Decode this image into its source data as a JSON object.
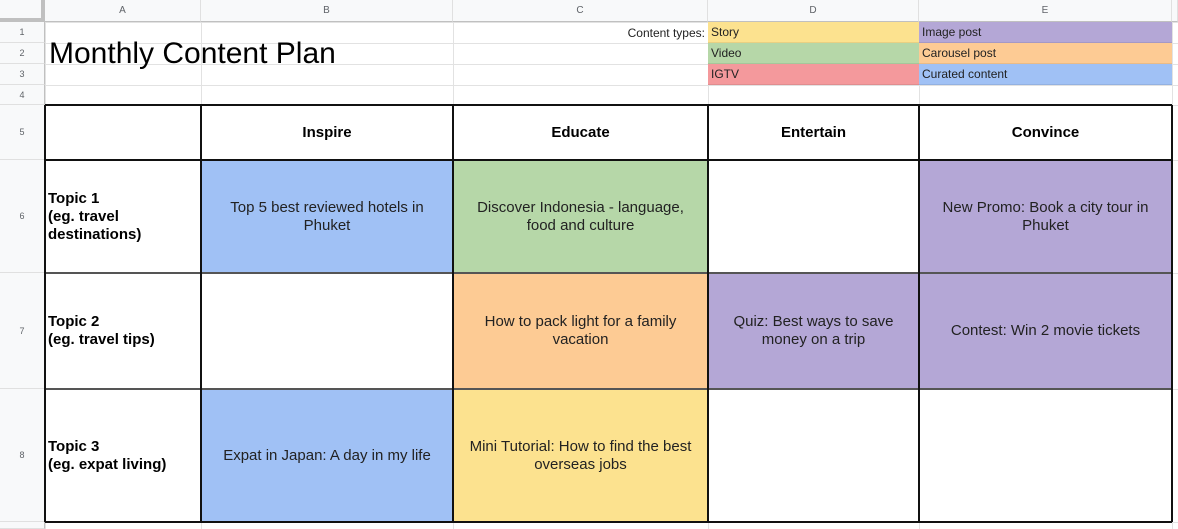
{
  "sheet": {
    "columns": [
      "A",
      "B",
      "C",
      "D",
      "E"
    ],
    "rows": [
      "1",
      "2",
      "3",
      "4",
      "5",
      "6",
      "7",
      "8"
    ]
  },
  "title": "Monthly Content Plan",
  "legend": {
    "label": "Content types:",
    "items": [
      {
        "name": "Story",
        "color": "#fce28f"
      },
      {
        "name": "Image post",
        "color": "#b4a7d6"
      },
      {
        "name": "Video",
        "color": "#b6d7a8"
      },
      {
        "name": "Carousel post",
        "color": "#fdcb94"
      },
      {
        "name": "IGTV",
        "color": "#f4999c"
      },
      {
        "name": "Curated content",
        "color": "#a0c1f5"
      }
    ]
  },
  "table": {
    "headers": [
      "Inspire",
      "Educate",
      "Entertain",
      "Convince"
    ],
    "topics": [
      {
        "label": "Topic 1\n(eg. travel\ndestinations)",
        "cells": [
          {
            "text": "Top 5 best reviewed hotels in Phuket",
            "type": "Curated content"
          },
          {
            "text": "Discover Indonesia - language, food and culture",
            "type": "Video"
          },
          {
            "text": "",
            "type": ""
          },
          {
            "text": "New Promo: Book a city tour in Phuket",
            "type": "Image post"
          }
        ]
      },
      {
        "label": "Topic 2\n(eg. travel tips)",
        "cells": [
          {
            "text": "",
            "type": ""
          },
          {
            "text": "How to pack light for a family vacation",
            "type": "Carousel post"
          },
          {
            "text": "Quiz: Best ways to save money on a trip",
            "type": "Image post"
          },
          {
            "text": "Contest: Win 2 movie tickets",
            "type": "Image post"
          }
        ]
      },
      {
        "label": "Topic 3\n(eg. expat living)",
        "cells": [
          {
            "text": "Expat in Japan: A day in my life",
            "type": "Curated content"
          },
          {
            "text": "Mini Tutorial: How to find the best overseas jobs",
            "type": "Story"
          },
          {
            "text": "",
            "type": ""
          },
          {
            "text": "",
            "type": ""
          }
        ]
      }
    ]
  }
}
